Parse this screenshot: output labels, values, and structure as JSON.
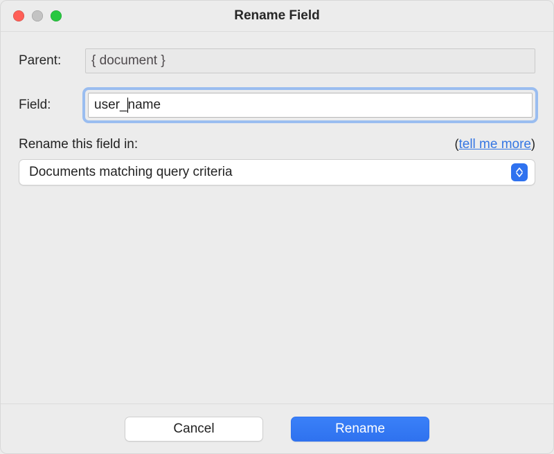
{
  "window": {
    "title": "Rename Field"
  },
  "form": {
    "parent_label": "Parent:",
    "parent_value": "{ document }",
    "field_label": "Field:",
    "field_value_before_caret": "user_",
    "field_value_after_caret": "name",
    "scope_label": "Rename this field in:",
    "tell_me_more": "tell me more",
    "scope_selected": "Documents matching query criteria"
  },
  "buttons": {
    "cancel": "Cancel",
    "rename": "Rename"
  }
}
